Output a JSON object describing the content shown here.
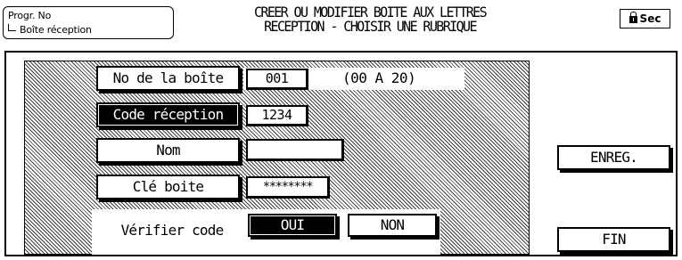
{
  "header": {
    "breadcrumb_line1": "Progr. No",
    "breadcrumb_line2": "Boîte réception",
    "title_line1": "CREER OU MODIFIER BOITE AUX LETTRES",
    "title_line2": "RECEPTION - CHOISIR UNE RUBRIQUE",
    "sec_label": "Sec"
  },
  "form": {
    "box_number": {
      "label": "No de la boîte",
      "value": "001",
      "range": "(00 A 20)"
    },
    "reception_code": {
      "label": "Code réception",
      "value": "1234"
    },
    "name": {
      "label": "Nom",
      "value": ""
    },
    "box_key": {
      "label": "Clé boite",
      "value": "********"
    },
    "verify_code": {
      "label": "Vérifier code",
      "yes": "OUI",
      "no": "NON",
      "selected": "OUI"
    }
  },
  "actions": {
    "save": "ENREG.",
    "end": "FIN"
  }
}
